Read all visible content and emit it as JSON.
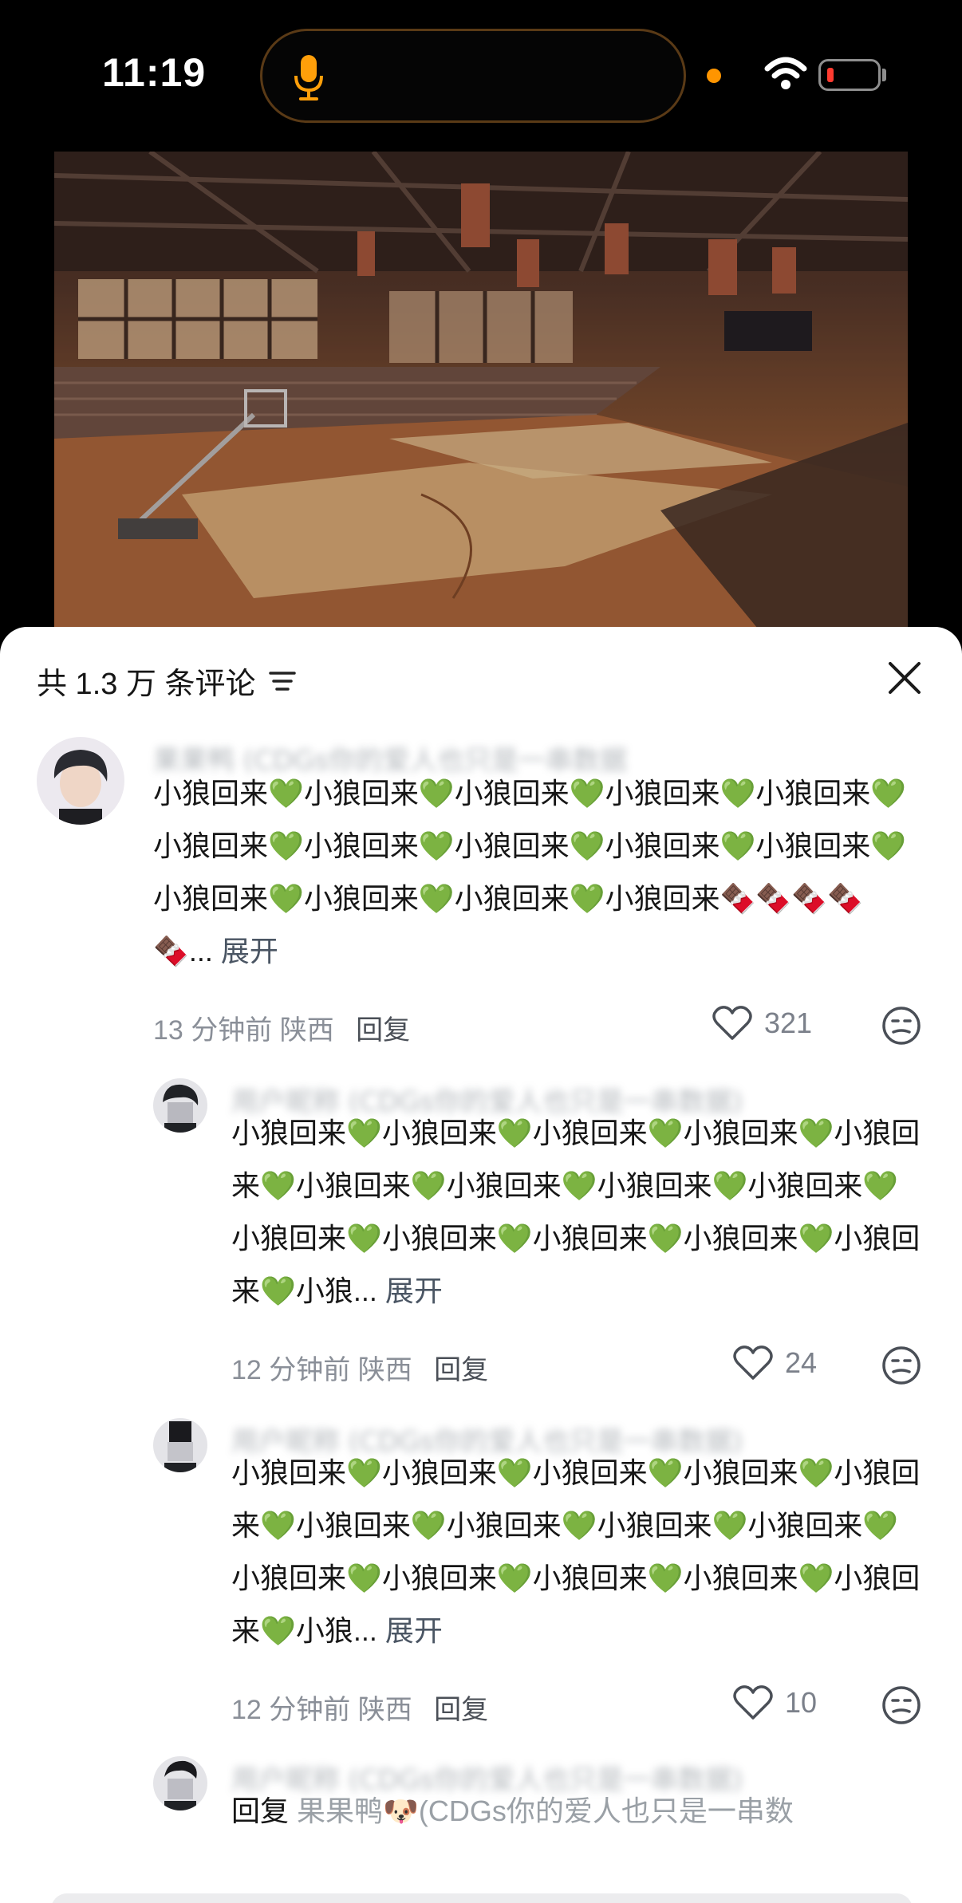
{
  "status_bar": {
    "time": "11:19"
  },
  "sheet": {
    "header_title": "共 1.3 万 条评论",
    "comments": [
      {
        "username": "果果鸭 (CDGs你的爱人也只是一串数据",
        "text": "小狼回来💚小狼回来💚小狼回来💚小狼回来💚小狼回来💚小狼回来💚小狼回来💚小狼回来💚小狼回来💚小狼回来💚小狼回来💚小狼回来💚小狼回来💚小狼回来🍫🍫🍫🍫🍫...",
        "expand": "展开",
        "time": "13 分钟前",
        "location": "陕西",
        "reply": "回复",
        "likes": "321"
      },
      {
        "username": "用户昵称 (CDGs你的爱人也只是一串数据)",
        "text": "小狼回来💚小狼回来💚小狼回来💚小狼回来💚小狼回来💚小狼回来💚小狼回来💚小狼回来💚小狼回来💚小狼回来💚小狼回来💚小狼回来💚小狼回来💚小狼回来💚小狼...",
        "expand": "展开",
        "time": "12 分钟前",
        "location": "陕西",
        "reply": "回复",
        "likes": "24"
      },
      {
        "username": "用户昵称 (CDGs你的爱人也只是一串数据)",
        "text": "小狼回来💚小狼回来💚小狼回来💚小狼回来💚小狼回来💚小狼回来💚小狼回来💚小狼回来💚小狼回来💚小狼回来💚小狼回来💚小狼回来💚小狼回来💚小狼回来💚小狼...",
        "expand": "展开",
        "time": "12 分钟前",
        "location": "陕西",
        "reply": "回复",
        "likes": "10"
      },
      {
        "username": "用户昵称 (CDGs你的爱人也只是一串数据)",
        "reply_prefix": "回复",
        "quoted": "果果鸭🐶(CDGs你的爱人也只是一串数"
      }
    ]
  }
}
